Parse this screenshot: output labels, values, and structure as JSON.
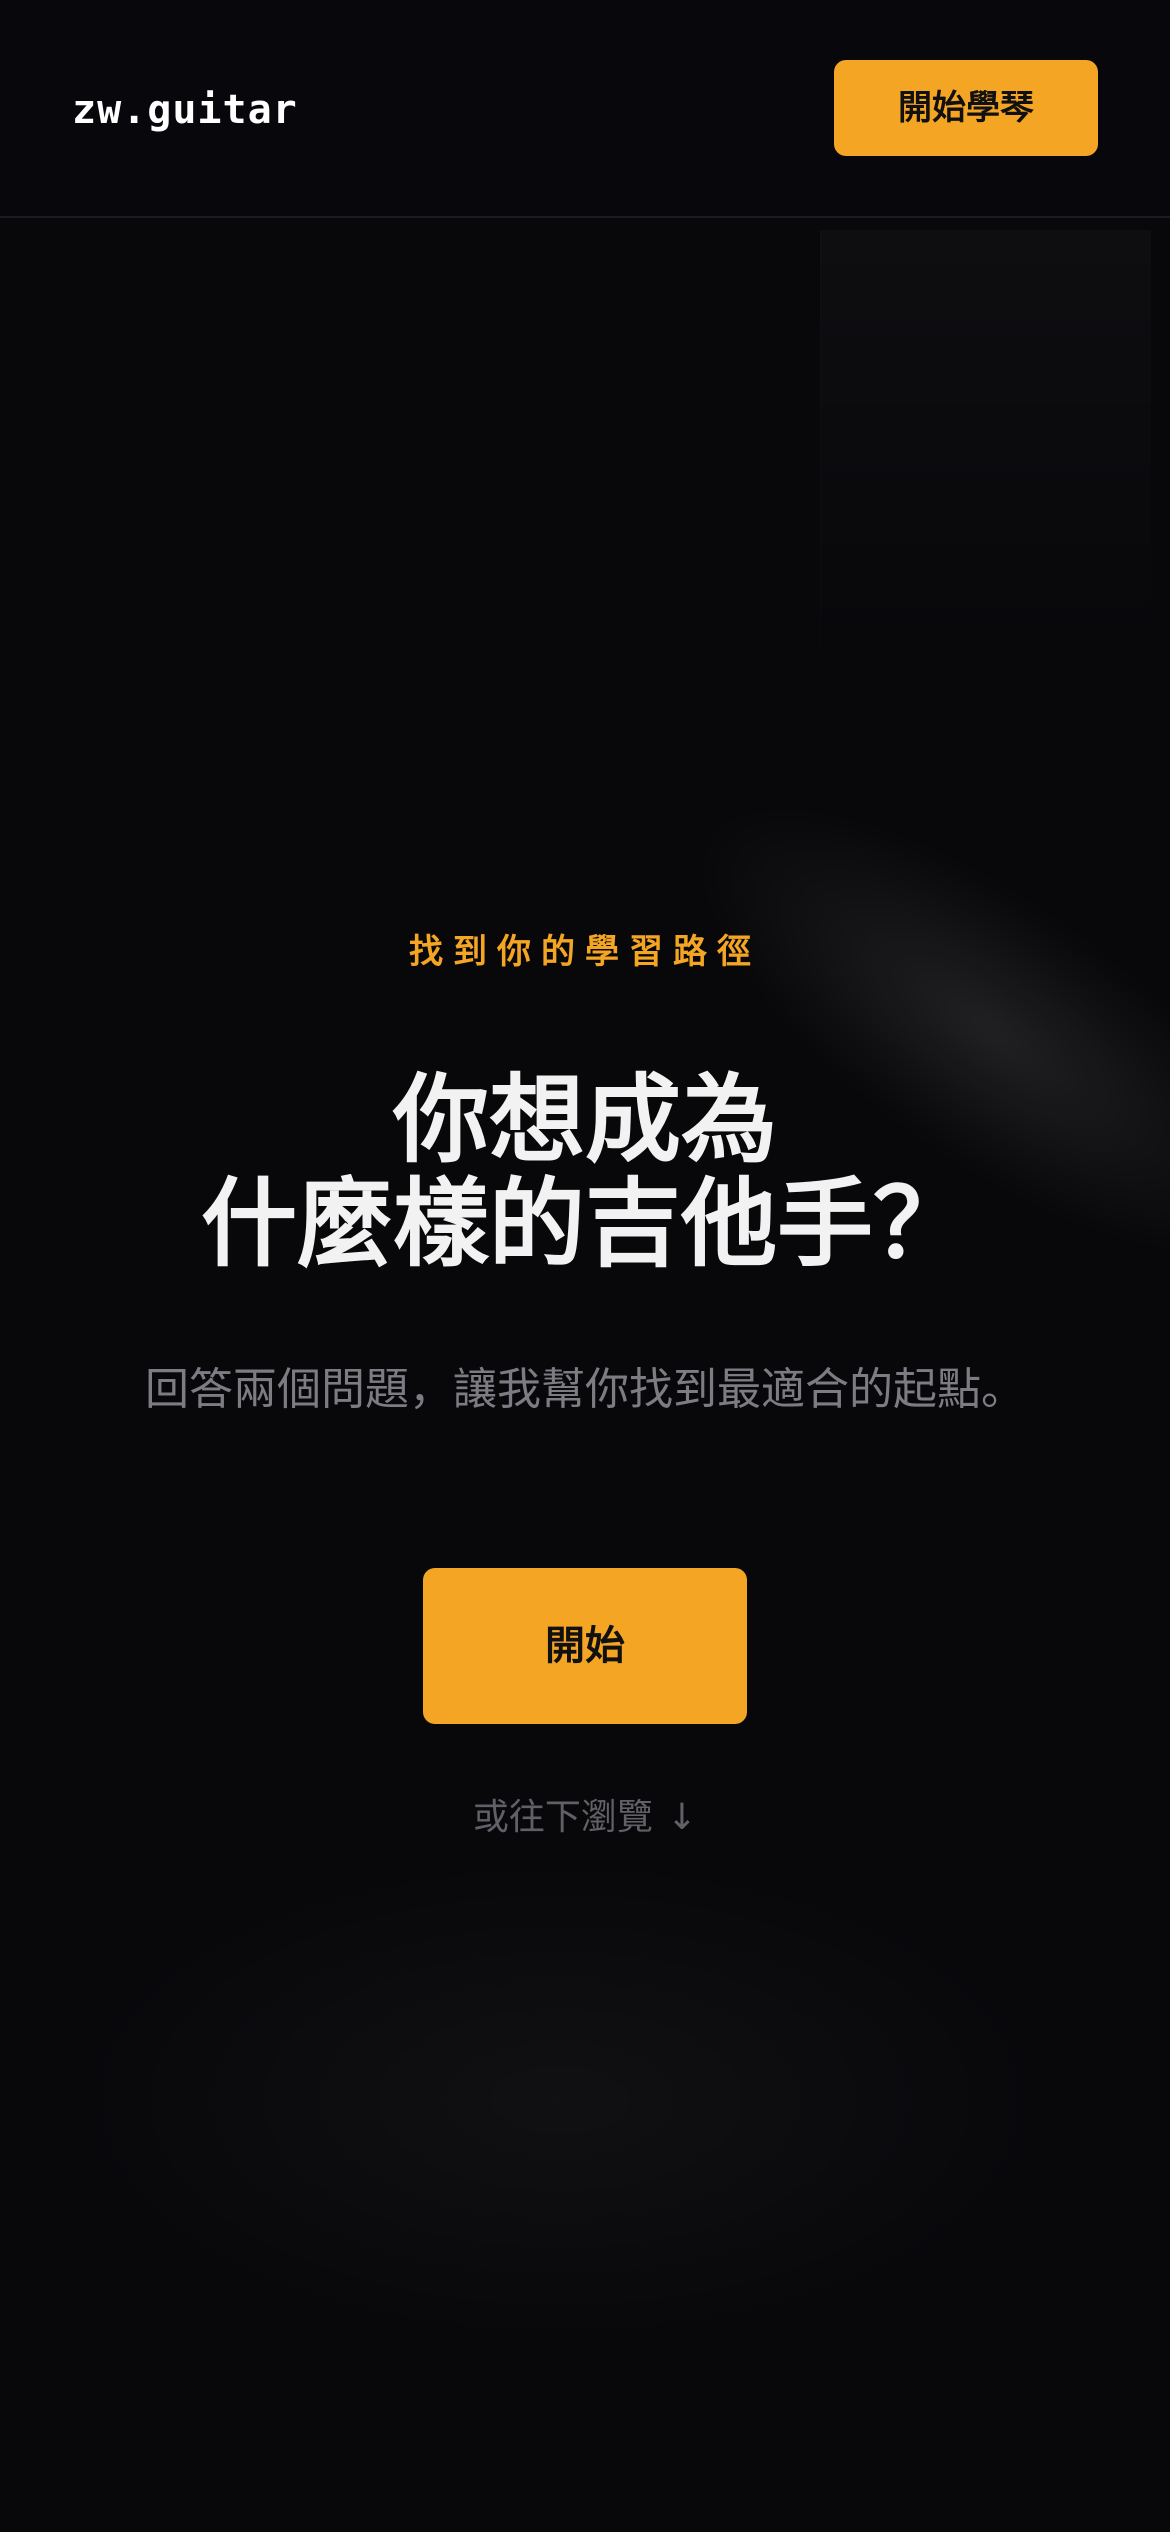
{
  "header": {
    "logo": "zw.guitar",
    "cta_label": "開始學琴"
  },
  "hero": {
    "eyebrow": "找到你的學習路徑",
    "headline_line1": "你想成為",
    "headline_line2": "什麼樣的吉他手？",
    "subtitle": "回答兩個問題，讓我幫你找到最適合的起點。",
    "start_label": "開始",
    "browse_label": "或往下瀏覽",
    "browse_arrow": "↓"
  },
  "colors": {
    "accent": "#f5a524",
    "background": "#08080b",
    "headline": "#f2f2f2",
    "muted": "#7c7c82"
  },
  "icons": {
    "browse_arrow_icon": "arrow-down-icon"
  }
}
